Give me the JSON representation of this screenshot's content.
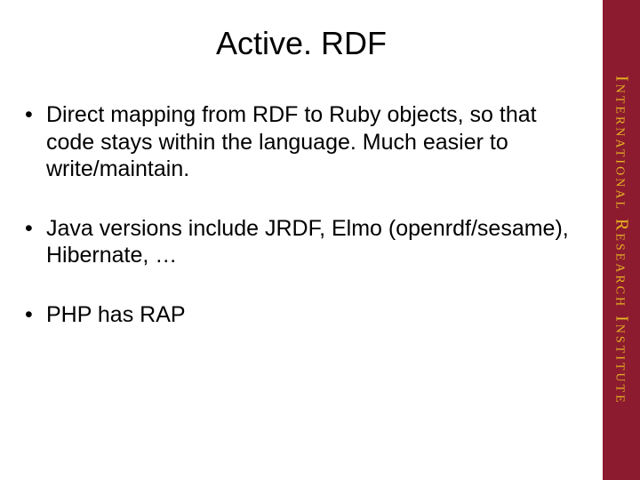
{
  "slide": {
    "title": "Active. RDF",
    "bullets": [
      "Direct mapping from RDF to Ruby objects, so that code stays within the language. Much easier to write/maintain.",
      "Java versions include JRDF, Elmo (openrdf/sesame), Hibernate, …",
      "PHP has RAP"
    ]
  },
  "sidebar": {
    "label": "International Research Institute"
  }
}
